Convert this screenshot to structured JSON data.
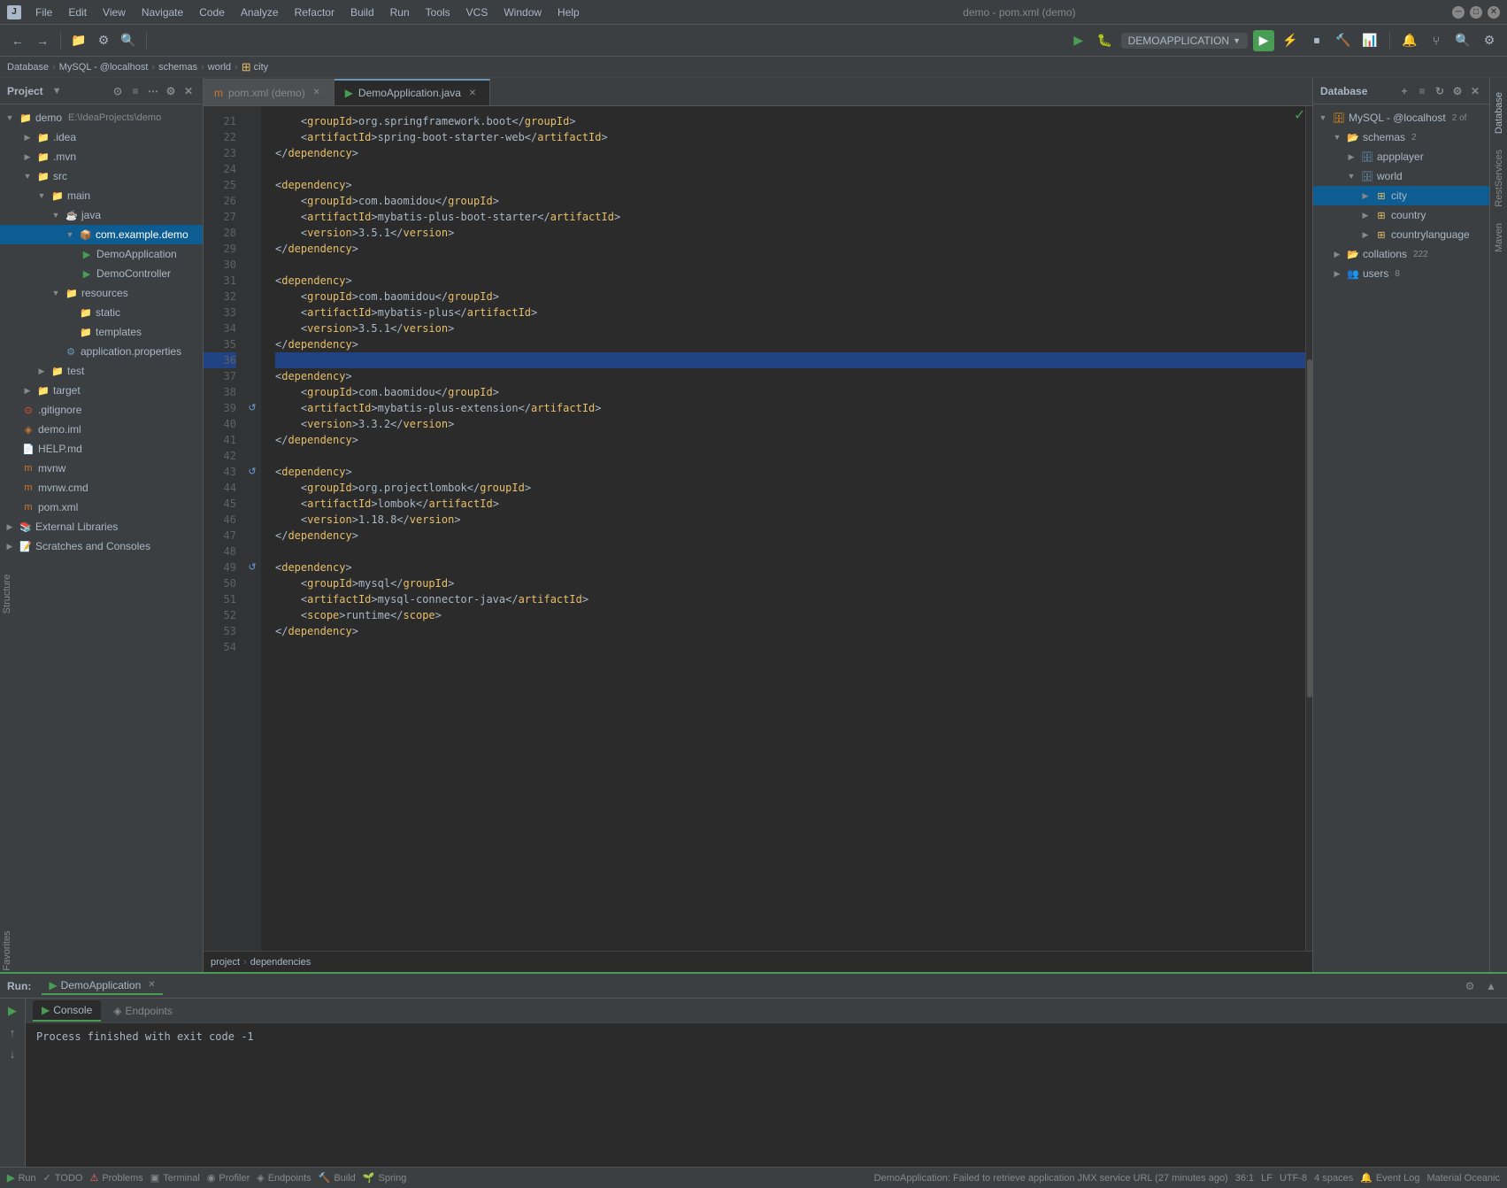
{
  "app": {
    "title": "demo - pom.xml (demo)",
    "icon": "▶"
  },
  "menubar": {
    "items": [
      "File",
      "Edit",
      "View",
      "Navigate",
      "Code",
      "Analyze",
      "Refactor",
      "Build",
      "Run",
      "Tools",
      "VCS",
      "Window",
      "Help"
    ]
  },
  "toolbar": {
    "run_config": "DEMOAPPLICATION",
    "run_config_dropdown": "▼"
  },
  "breadcrumb": {
    "items": [
      "Database",
      "MySQL - @localhost",
      "schemas",
      "world",
      "city"
    ],
    "separators": [
      ">",
      ">",
      ">",
      ">"
    ]
  },
  "sidebar": {
    "header": "Project",
    "items": [
      {
        "label": "demo E:\\IdeaProjects\\demo",
        "indent": 0,
        "type": "root",
        "expanded": true
      },
      {
        "label": ".idea",
        "indent": 1,
        "type": "folder"
      },
      {
        "label": ".mvn",
        "indent": 1,
        "type": "folder"
      },
      {
        "label": "src",
        "indent": 1,
        "type": "folder",
        "expanded": true
      },
      {
        "label": "main",
        "indent": 2,
        "type": "folder",
        "expanded": true
      },
      {
        "label": "java",
        "indent": 3,
        "type": "folder",
        "expanded": true
      },
      {
        "label": "com.example.demo",
        "indent": 4,
        "type": "package",
        "expanded": true,
        "selected": true
      },
      {
        "label": "DemoApplication",
        "indent": 5,
        "type": "java"
      },
      {
        "label": "DemoController",
        "indent": 5,
        "type": "java"
      },
      {
        "label": "resources",
        "indent": 3,
        "type": "folder",
        "expanded": true
      },
      {
        "label": "static",
        "indent": 4,
        "type": "folder"
      },
      {
        "label": "templates",
        "indent": 4,
        "type": "folder"
      },
      {
        "label": "application.properties",
        "indent": 4,
        "type": "properties"
      },
      {
        "label": "test",
        "indent": 2,
        "type": "folder"
      },
      {
        "label": "target",
        "indent": 1,
        "type": "folder"
      },
      {
        "label": ".gitignore",
        "indent": 1,
        "type": "git"
      },
      {
        "label": "demo.iml",
        "indent": 1,
        "type": "module"
      },
      {
        "label": "HELP.md",
        "indent": 1,
        "type": "md"
      },
      {
        "label": "mvnw",
        "indent": 1,
        "type": "file"
      },
      {
        "label": "mvnw.cmd",
        "indent": 1,
        "type": "file"
      },
      {
        "label": "pom.xml",
        "indent": 1,
        "type": "xml"
      },
      {
        "label": "External Libraries",
        "indent": 0,
        "type": "lib"
      },
      {
        "label": "Scratches and Consoles",
        "indent": 0,
        "type": "scratch"
      }
    ]
  },
  "tabs": [
    {
      "label": "pom.xml (demo)",
      "active": false,
      "icon": "xml"
    },
    {
      "label": "DemoApplication.java",
      "active": true,
      "icon": "java"
    }
  ],
  "code": {
    "lines": [
      {
        "num": 21,
        "content": "    <groupId>org.springframework.boot</groupId>",
        "indent": 4
      },
      {
        "num": 22,
        "content": "    <artifactId>spring-boot-starter-web</artifactId>",
        "indent": 4
      },
      {
        "num": 23,
        "content": "</dependency>",
        "indent": 0
      },
      {
        "num": 24,
        "content": ""
      },
      {
        "num": 25,
        "content": "<dependency>",
        "indent": 0
      },
      {
        "num": 26,
        "content": "    <groupId>com.baomidou</groupId>",
        "indent": 4
      },
      {
        "num": 27,
        "content": "    <artifactId>mybatis-plus-boot-starter</artifactId>",
        "indent": 4
      },
      {
        "num": 28,
        "content": "    <version>3.5.1</version>",
        "indent": 4
      },
      {
        "num": 29,
        "content": "</dependency>",
        "indent": 0
      },
      {
        "num": 30,
        "content": ""
      },
      {
        "num": 31,
        "content": "<dependency>",
        "indent": 0
      },
      {
        "num": 32,
        "content": "    <groupId>com.baomidou</groupId>",
        "indent": 4
      },
      {
        "num": 33,
        "content": "    <artifactId>mybatis-plus</artifactId>",
        "indent": 4
      },
      {
        "num": 34,
        "content": "    <version>3.5.1</version>",
        "indent": 4
      },
      {
        "num": 35,
        "content": "</dependency>",
        "indent": 0
      },
      {
        "num": 36,
        "content": "",
        "selected": true
      },
      {
        "num": 37,
        "content": "<dependency>",
        "indent": 0
      },
      {
        "num": 38,
        "content": "    <groupId>com.baomidou</groupId>",
        "indent": 4
      },
      {
        "num": 39,
        "content": "    <artifactId>mybatis-plus-extension</artifactId>",
        "indent": 4
      },
      {
        "num": 40,
        "content": "    <version>3.3.2</version>",
        "indent": 4
      },
      {
        "num": 41,
        "content": "</dependency>",
        "indent": 0
      },
      {
        "num": 42,
        "content": ""
      },
      {
        "num": 43,
        "content": "<dependency>",
        "indent": 0
      },
      {
        "num": 44,
        "content": "    <groupId>org.projectlombok</groupId>",
        "indent": 4
      },
      {
        "num": 45,
        "content": "    <artifactId>lombok</artifactId>",
        "indent": 4
      },
      {
        "num": 46,
        "content": "    <version>1.18.8</version>",
        "indent": 4
      },
      {
        "num": 47,
        "content": "</dependency>",
        "indent": 0
      },
      {
        "num": 48,
        "content": ""
      },
      {
        "num": 49,
        "content": "<dependency>",
        "indent": 0
      },
      {
        "num": 50,
        "content": "    <groupId>mysql</groupId>",
        "indent": 4
      },
      {
        "num": 51,
        "content": "    <artifactId>mysql-connector-java</artifactId>",
        "indent": 4
      },
      {
        "num": 52,
        "content": "    <scope>runtime</scope>",
        "indent": 4
      },
      {
        "num": 53,
        "content": "</dependency>",
        "indent": 0
      },
      {
        "num": 54,
        "content": ""
      }
    ]
  },
  "footer_breadcrumb": {
    "items": [
      "project",
      "dependencies"
    ]
  },
  "database_panel": {
    "header": "Database",
    "tree": [
      {
        "label": "MySQL - @localhost",
        "indent": 0,
        "badge": "2 of",
        "type": "db",
        "expanded": true
      },
      {
        "label": "schemas",
        "indent": 1,
        "badge": "2",
        "type": "schema",
        "expanded": true
      },
      {
        "label": "appplayer",
        "indent": 2,
        "type": "schema_item"
      },
      {
        "label": "world",
        "indent": 2,
        "type": "schema_item",
        "expanded": true
      },
      {
        "label": "city",
        "indent": 3,
        "type": "table",
        "selected": true
      },
      {
        "label": "country",
        "indent": 3,
        "type": "table"
      },
      {
        "label": "countrylanguage",
        "indent": 3,
        "type": "table"
      },
      {
        "label": "collations",
        "indent": 1,
        "badge": "222",
        "type": "collation"
      },
      {
        "label": "users",
        "indent": 1,
        "badge": "8",
        "type": "table"
      }
    ]
  },
  "run_panel": {
    "header": "Run:",
    "app_name": "DemoApplication",
    "tabs": [
      {
        "label": "Console",
        "active": true,
        "icon": "▶"
      },
      {
        "label": "Endpoints",
        "active": false,
        "icon": "◈"
      }
    ],
    "console_text": "Process finished with exit code -1"
  },
  "status_bar": {
    "git": "DemoApplication: Failed to retrieve application JMX service URL (27 minutes ago)",
    "position": "36:1",
    "encoding": "UTF-8",
    "indent": "4 spaces",
    "event_log": "Event Log",
    "todo": "TODO",
    "problems": "Problems",
    "terminal": "Terminal",
    "profiler": "Profiler",
    "endpoints": "Endpoints",
    "build": "Build",
    "spring": "Spring"
  },
  "bottom_toolbar_items": [
    "Run",
    "TODO",
    "Problems",
    "Terminal",
    "Profiler",
    "Endpoints",
    "Build",
    "Spring"
  ],
  "colors": {
    "accent_green": "#499c54",
    "accent_blue": "#6897bb",
    "selected_bg": "#0d5d92",
    "editor_bg": "#2b2b2b",
    "panel_bg": "#3c3f41",
    "xml_tag": "#e8bf6a",
    "xml_text": "#a9b7c6"
  }
}
